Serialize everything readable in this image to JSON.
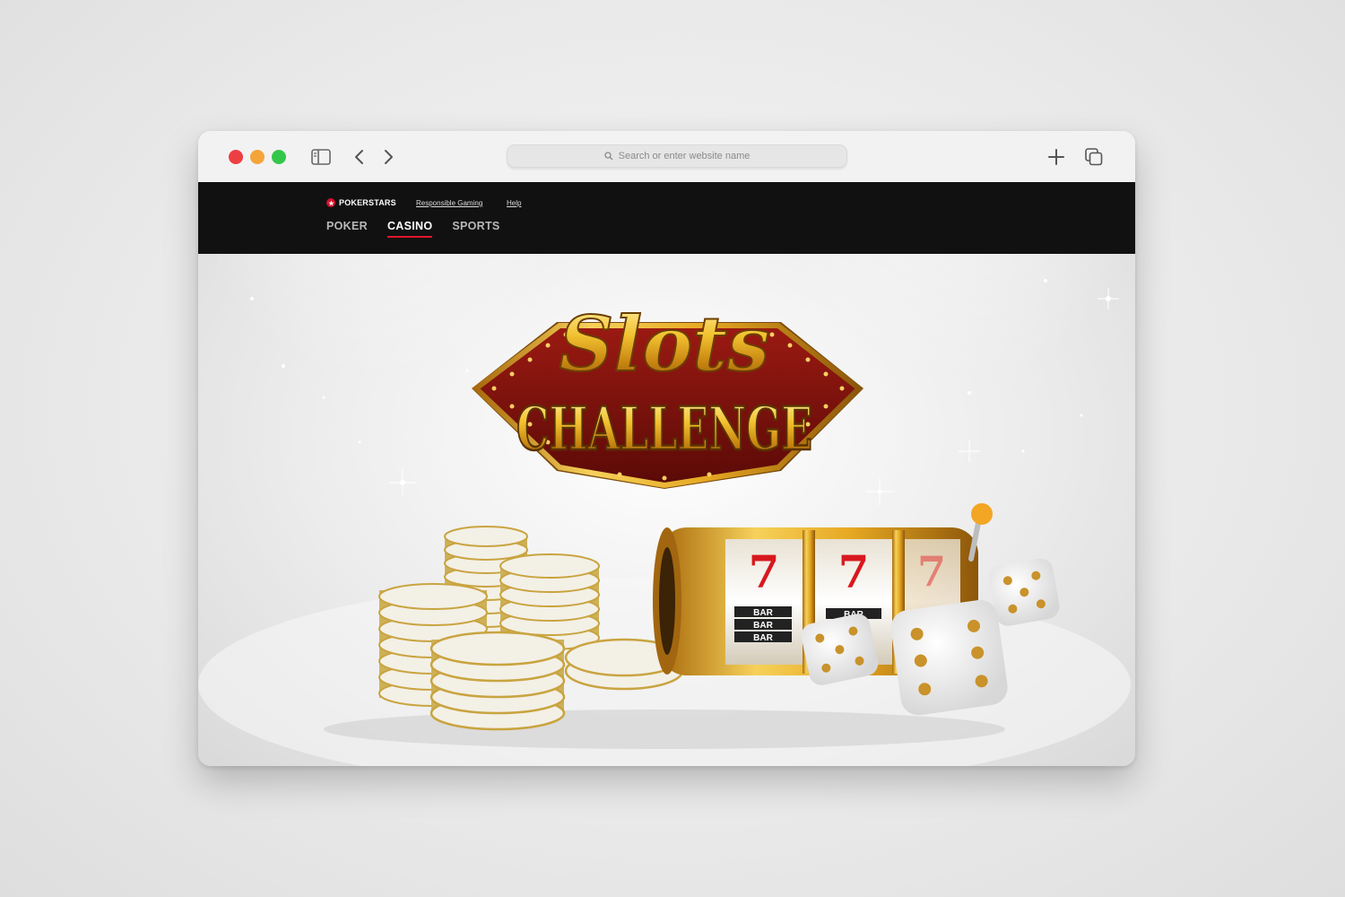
{
  "browser": {
    "address_placeholder": "Search or enter website name",
    "icons": [
      "sidebar-icon",
      "back-icon",
      "forward-icon",
      "search-icon",
      "plus-icon",
      "tabs-icon"
    ]
  },
  "site": {
    "brand": "POKERSTARS",
    "links": {
      "responsible": "Responsible Gaming",
      "help": "Help"
    },
    "nav": [
      "POKER",
      "CASINO",
      "SPORTS"
    ],
    "active_nav": "CASINO",
    "accent_color": "#e0162b"
  },
  "hero": {
    "title_line1": "Slots",
    "title_line2": "CHALLENGE",
    "reel_symbol": "7",
    "reel_bar": "BAR"
  }
}
